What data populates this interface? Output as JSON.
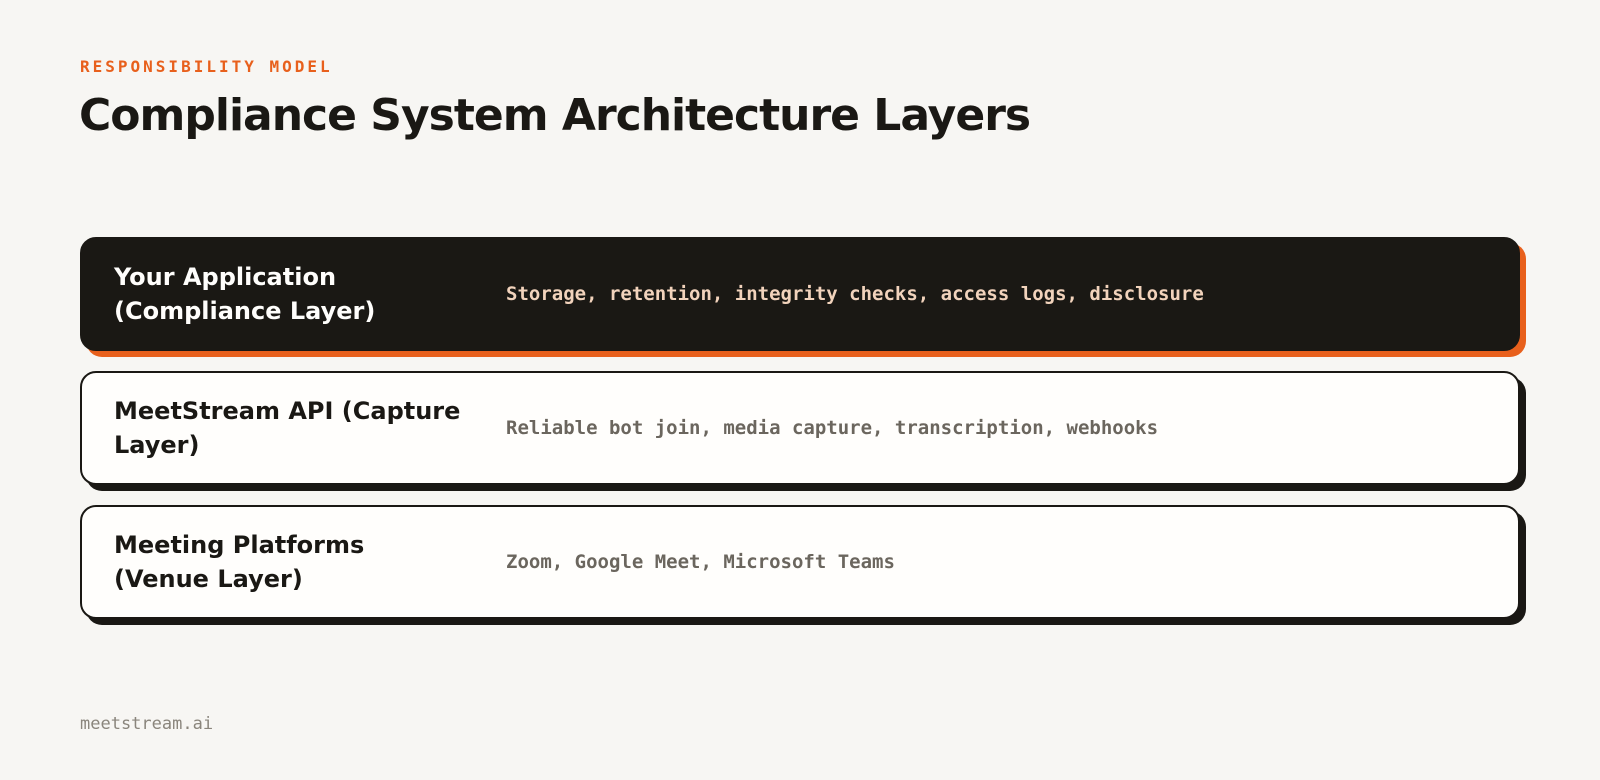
{
  "header": {
    "eyebrow": "RESPONSIBILITY MODEL",
    "title": "Compliance System Architecture Layers"
  },
  "layers": [
    {
      "name": "Your Application (Compliance Layer)",
      "description": "Storage, retention, integrity checks, access logs, disclosure",
      "highlighted": true
    },
    {
      "name": "MeetStream API (Capture Layer)",
      "description": "Reliable bot join, media capture, transcription, webhooks",
      "highlighted": false
    },
    {
      "name": "Meeting Platforms (Venue Layer)",
      "description": "Zoom, Google Meet, Microsoft Teams",
      "highlighted": false
    }
  ],
  "footer": {
    "brand": "meetstream.ai"
  },
  "colors": {
    "accent": "#e8601c",
    "dark": "#1a1814",
    "background": "#f7f6f3",
    "card": "#fffefc"
  }
}
